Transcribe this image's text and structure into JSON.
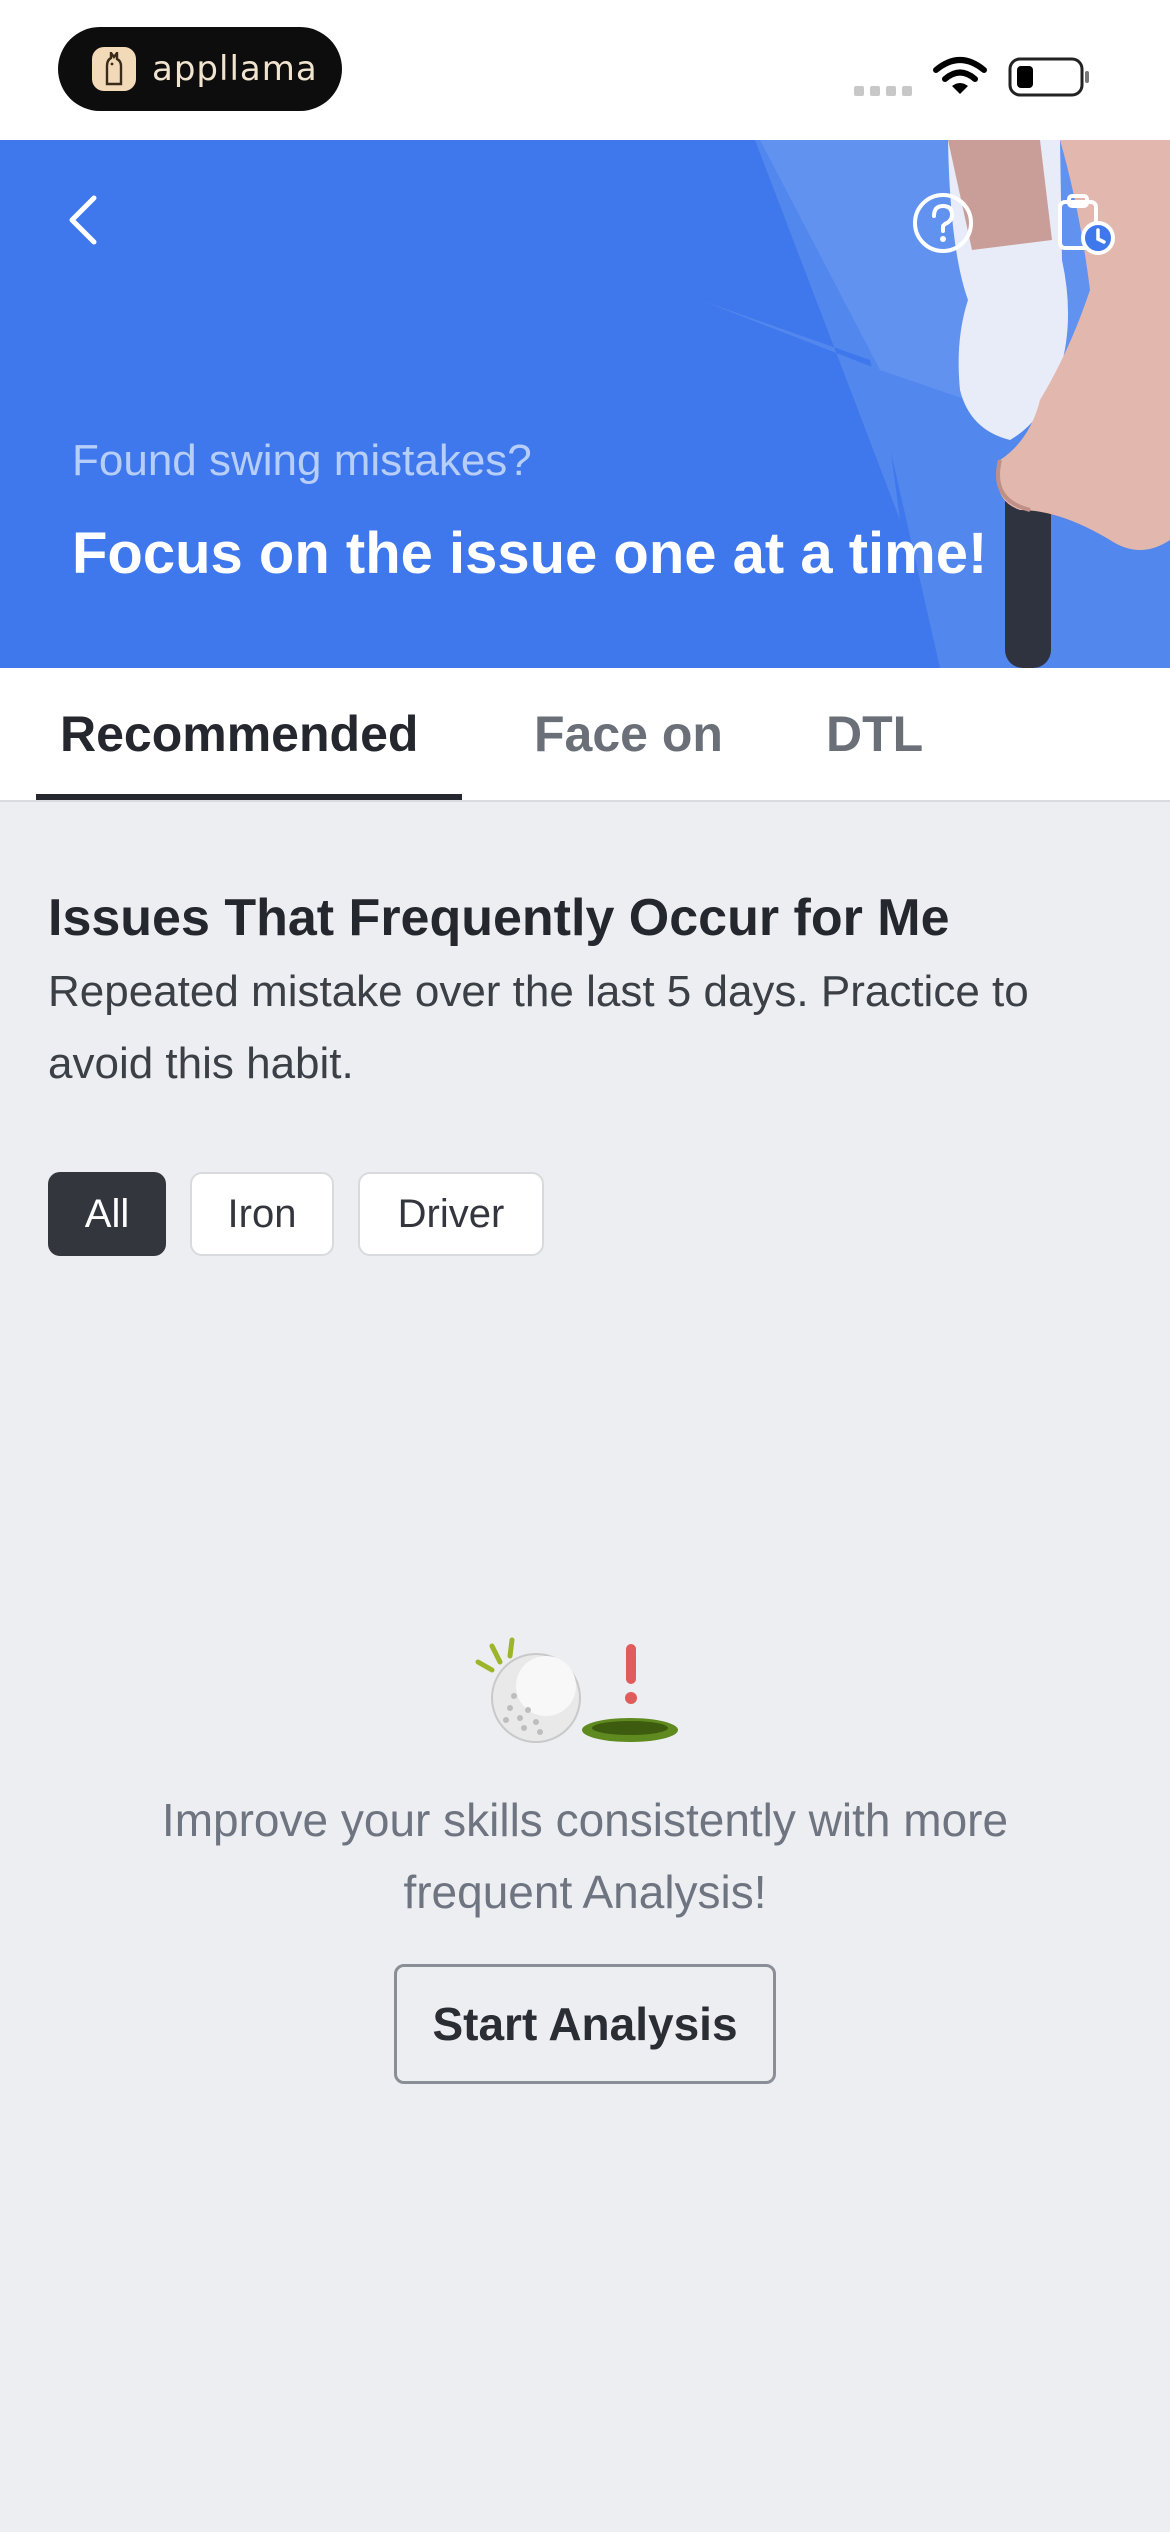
{
  "status_bar": {
    "brand_name": "appllama",
    "icons": [
      "signal-dots-icon",
      "wifi-icon",
      "battery-icon"
    ]
  },
  "header": {
    "back_icon": "chevron-left-icon",
    "help_icon": "question-circle-icon",
    "history_icon": "clipboard-clock-icon",
    "subtitle": "Found swing mistakes?",
    "title": "Focus on the issue one at a time!",
    "background_color": "#3f78ec"
  },
  "tabs": [
    {
      "label": "Recommended",
      "active": true
    },
    {
      "label": "Face on",
      "active": false
    },
    {
      "label": "DTL",
      "active": false
    }
  ],
  "section": {
    "title": "Issues That Frequently Occur for Me",
    "description": "Repeated mistake over the last 5 days. Practice to avoid this habit."
  },
  "filters": [
    {
      "label": "All",
      "selected": true
    },
    {
      "label": "Iron",
      "selected": false
    },
    {
      "label": "Driver",
      "selected": false
    }
  ],
  "empty_state": {
    "illustration": "golf-ball-hole-icon",
    "message": "Improve your skills consistently with more frequent Analysis!",
    "button_label": "Start Analysis"
  }
}
